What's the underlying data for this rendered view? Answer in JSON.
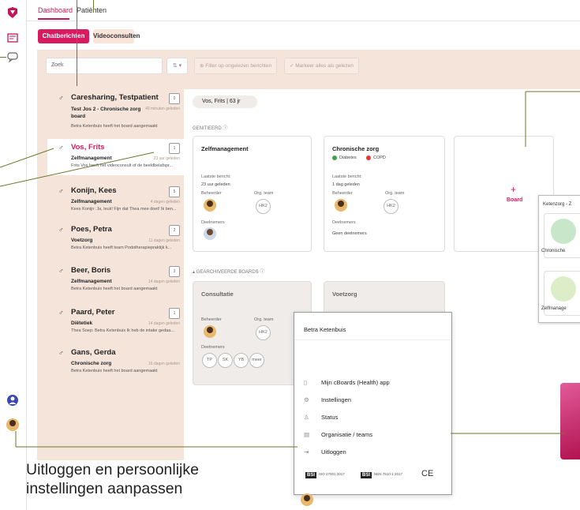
{
  "nav": {
    "tabs": [
      "Dashboard",
      "Patiënten"
    ]
  },
  "subtabs": [
    "Chatberichten",
    "Videoconsulten"
  ],
  "search": {
    "placeholder": "Zoek"
  },
  "filters": {
    "unread": "Filter op ongelezen berichten",
    "mark_read": "Markeer alles als gelezen"
  },
  "conversations": [
    {
      "name": "Caresharing, Testpatient",
      "topic": "Test Jos 2 - Chronische zorg board",
      "time": "49 minuten geleden",
      "message": "Betra Ketenbuis heeft het board aangemaakt",
      "count": "0"
    },
    {
      "name": "Vos, Frits",
      "topic": "Zelfmanagement",
      "time": "23 uur geleden",
      "message": "Frits Vos heeft het videoconsult of de beeldbelafspr...",
      "count": "1"
    },
    {
      "name": "Konijn, Kees",
      "topic": "Zelfmanagement",
      "time": "4 dagen geleden",
      "message": "Kees Konijn: Ja, leuk! Fijn dat Thea mee doet! Ik ben...",
      "count": "5"
    },
    {
      "name": "Poes, Petra",
      "topic": "Voetzorg",
      "time": "11 dagen geleden",
      "message": "Betra Ketenbuis heeft team Podotherapiepraktijk k...",
      "count": "2"
    },
    {
      "name": "Beer, Boris",
      "topic": "Zelfmanagement",
      "time": "14 dagen geleden",
      "message": "Betra Ketenbuis heeft het board aangemaakt",
      "count": "3"
    },
    {
      "name": "Paard, Peter",
      "topic": "Diëtetiek",
      "time": "14 dagen geleden",
      "message": "Thea Soep: Betra Ketenbuis Ik heb de intake gedaa...",
      "count": "1"
    },
    {
      "name": "Gans, Gerda",
      "topic": "Chronische zorg",
      "time": "16 dagen geleden",
      "message": "Betra Ketenbuis heeft het board aangemaakt",
      "count": ""
    }
  ],
  "patient_pill": "Vos, Frits | 63 jr",
  "sections": {
    "started": "GENITIEERD",
    "archived": "GEARCHIVEERDE BOARDS"
  },
  "labels": {
    "last_message": "Laatste bericht:",
    "manager": "Beheerder",
    "org_team": "Org. team",
    "participants": "Deelnemers",
    "no_participants": "Geen deelnemers",
    "hk2": "HK2"
  },
  "boards": [
    {
      "title": "Zelfmanagement",
      "last": "23 uur geleden"
    },
    {
      "title": "Chronische zorg",
      "last": "1 dag geleden",
      "tags": [
        "Diabetes",
        "COPD"
      ]
    }
  ],
  "add_board": {
    "plus": "+",
    "label": "Board"
  },
  "archived_boards": [
    {
      "title": "Consultatie",
      "participants": [
        "TP",
        "SK",
        "YB",
        "meer"
      ]
    },
    {
      "title": "Voetzorg"
    }
  ],
  "ketenzorg": {
    "title": "Ketenzorg - Z",
    "items": [
      "Chronische",
      "Zelfmanage"
    ]
  },
  "menu": {
    "user": "Betra Ketenbuis",
    "items": [
      {
        "label": "Mijn cBoards (Health) app",
        "icon": "phone-icon"
      },
      {
        "label": "Instellingen",
        "icon": "gear-icon"
      },
      {
        "label": "Status",
        "icon": "person-icon"
      },
      {
        "label": "Organisatie / teams",
        "icon": "org-icon"
      },
      {
        "label": "Uitloggen",
        "icon": "logout-icon"
      }
    ],
    "certs": [
      "ISO 27001:2017",
      "NEN 7510-1:2017",
      "CE"
    ]
  },
  "caption": "Uitloggen en persoonlijke instellingen aanpassen",
  "colors": {
    "accent": "#d81b60",
    "beige": "#f5e4da",
    "callout": "#6b7a2b"
  }
}
